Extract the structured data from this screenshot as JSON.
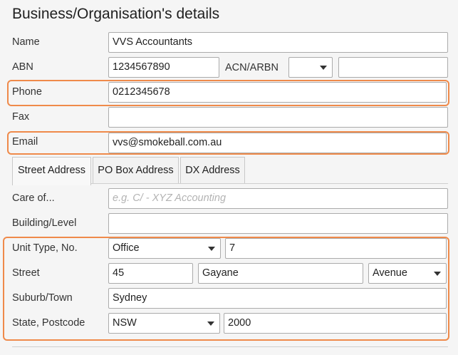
{
  "section_title": "Business/Organisation's details",
  "fields": {
    "name": {
      "label": "Name",
      "value": "VVS Accountants"
    },
    "abn": {
      "label": "ABN",
      "value": "1234567890"
    },
    "acn": {
      "label": "ACN/ARBN",
      "value": ""
    },
    "phone": {
      "label": "Phone",
      "value": "0212345678"
    },
    "fax": {
      "label": "Fax",
      "value": ""
    },
    "email": {
      "label": "Email",
      "value": "vvs@smokeball.com.au"
    }
  },
  "tabs": [
    {
      "label": "Street Address",
      "active": true
    },
    {
      "label": "PO Box Address",
      "active": false
    },
    {
      "label": "DX Address",
      "active": false
    }
  ],
  "address": {
    "care_of": {
      "label": "Care of...",
      "value": "",
      "placeholder": "e.g. C/ - XYZ Accounting"
    },
    "building": {
      "label": "Building/Level",
      "value": ""
    },
    "unit": {
      "label": "Unit Type, No.",
      "type": "Office",
      "number": "7"
    },
    "street": {
      "label": "Street",
      "number": "45",
      "name": "Gayane",
      "type": "Avenue"
    },
    "suburb": {
      "label": "Suburb/Town",
      "value": "Sydney"
    },
    "state": {
      "label": "State, Postcode",
      "state": "NSW",
      "postcode": "2000"
    }
  },
  "colors": {
    "highlight": "#ef8a4a",
    "input_border": "#ababab"
  }
}
